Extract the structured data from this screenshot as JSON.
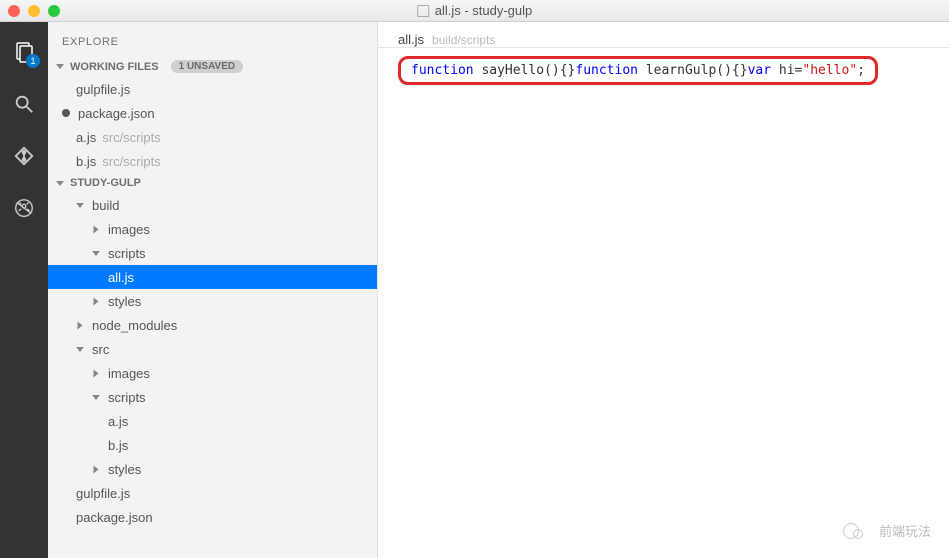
{
  "window": {
    "title": "all.js - study-gulp"
  },
  "activitybar": {
    "badge": "1"
  },
  "explorer": {
    "title": "EXPLORE",
    "workingFiles": {
      "label": "WORKING FILES",
      "unsavedBadge": "1 UNSAVED",
      "items": [
        {
          "name": "gulpfile.js",
          "dim": "",
          "dirty": false
        },
        {
          "name": "package.json",
          "dim": "",
          "dirty": true
        },
        {
          "name": "a.js",
          "dim": "src/scripts",
          "dirty": false
        },
        {
          "name": "b.js",
          "dim": "src/scripts",
          "dirty": false
        }
      ]
    },
    "project": {
      "name": "STUDY-GULP",
      "tree": {
        "build": "build",
        "build_images": "images",
        "build_scripts": "scripts",
        "build_scripts_all": "all.js",
        "build_styles": "styles",
        "node_modules": "node_modules",
        "src": "src",
        "src_images": "images",
        "src_scripts": "scripts",
        "src_scripts_a": "a.js",
        "src_scripts_b": "b.js",
        "src_styles": "styles",
        "gulpfile": "gulpfile.js",
        "packagejson": "package.json"
      }
    }
  },
  "editor": {
    "tabName": "all.js",
    "tabPath": "build/scripts",
    "code": {
      "kw_function1": "function",
      "fn1": " sayHello(){}",
      "kw_function2": "function",
      "fn2": " learnGulp(){}",
      "kw_var": "var",
      "varpart": " hi=",
      "str": "\"hello\"",
      "end": ";"
    }
  },
  "watermark": "前端玩法"
}
